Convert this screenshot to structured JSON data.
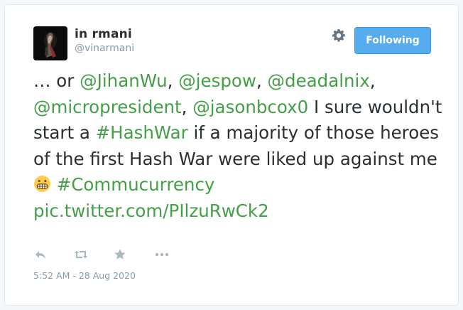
{
  "user": {
    "display_name": "in rmani",
    "handle": "@vinarmani"
  },
  "header": {
    "follow_button_label": "Following",
    "settings_icon": "gear-icon"
  },
  "tweet": {
    "segments": {
      "s0": "… or ",
      "m1": "@JihanWu",
      "s1": ", ",
      "m2": "@jespow",
      "s2": ", ",
      "m3": "@deadalnix",
      "s3": ", ",
      "m4": "@micropresident",
      "s4": ", ",
      "m5": "@jasonbcox0",
      "s5": " I sure wouldn't start a ",
      "h1": "#HashWar",
      "s6": " if a majority of those heroes of the first Hash War were liked up against me ",
      "s7": " ",
      "h2": "#Commucurrency",
      "s8": " ",
      "pic": "pic.twitter.com/PIlzuRwCk2"
    },
    "emoji": "grimacing-face-emoji",
    "timestamp": "5:52 AM - 28 Aug 2020"
  },
  "actions": {
    "icons": [
      "reply-icon",
      "retweet-icon",
      "favorite-star-icon",
      "more-dots-icon"
    ]
  },
  "colors": {
    "link": "#43a047",
    "follow_button": "#55acee",
    "text": "#292f33",
    "muted": "#8899a6"
  }
}
